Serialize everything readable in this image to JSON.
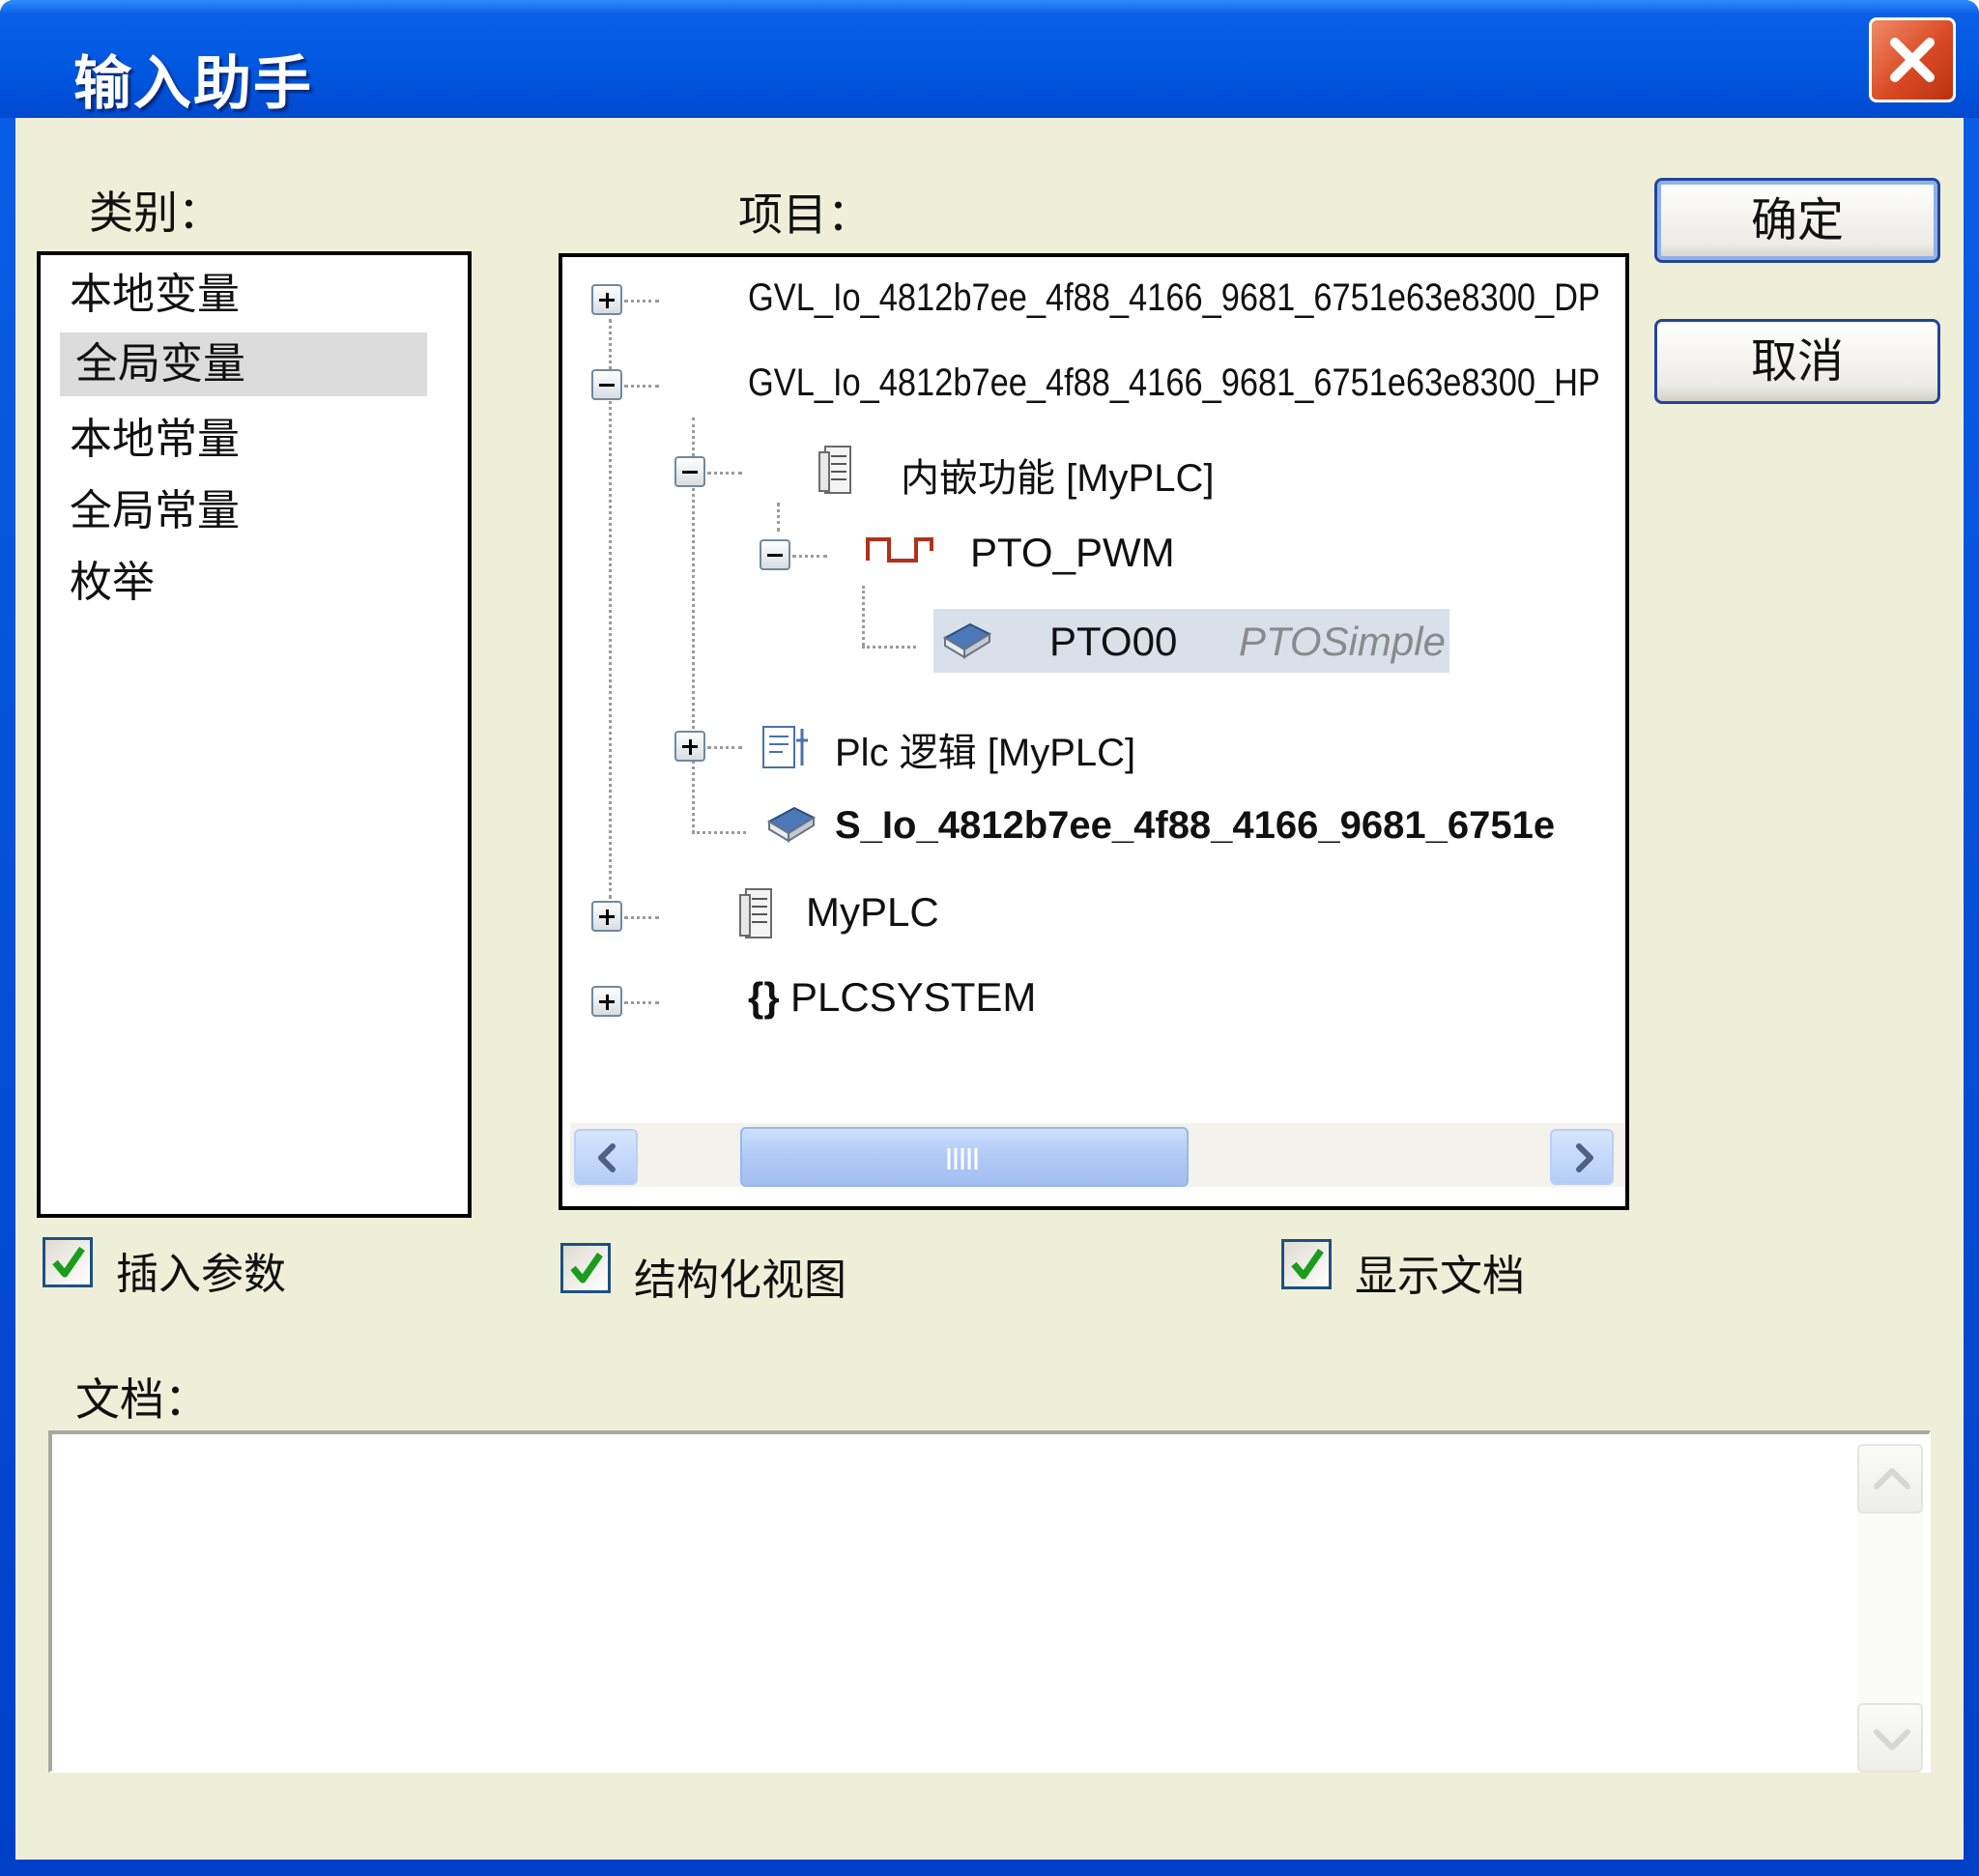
{
  "window": {
    "title": "输入助手"
  },
  "categories": {
    "label": "类别：",
    "items": [
      "本地变量",
      "全局变量",
      "本地常量",
      "全局常量",
      "枚举"
    ],
    "selected": "全局变量"
  },
  "items_panel": {
    "label": "项目：",
    "tree": {
      "gvl_dp": "GVL_Io_4812b7ee_4f88_4166_9681_6751e63e8300_DP",
      "gvl_hp": "GVL_Io_4812b7ee_4f88_4166_9681_6751e63e8300_HP",
      "embedded": "内嵌功能 [MyPLC]",
      "pto_pwm": "PTO_PWM",
      "pto00_name": "PTO00",
      "pto00_type": "PTOSimple",
      "plc_logic": "Plc 逻辑 [MyPLC]",
      "s_io": "S_Io_4812b7ee_4f88_4166_9681_6751e",
      "myplc": "MyPLC",
      "plcsystem_icon": "{}",
      "plcsystem": "PLCSYSTEM"
    }
  },
  "buttons": {
    "ok": "确定",
    "cancel": "取消"
  },
  "options": {
    "insert_args": {
      "label": "插入参数",
      "checked": true
    },
    "structured_view": {
      "label": "结构化视图",
      "checked": true
    },
    "show_docs": {
      "label": "显示文档",
      "checked": true
    }
  },
  "documentation": {
    "label": "文档：",
    "content": ""
  },
  "colors": {
    "title_blue": "#0057e0",
    "client_bg": "#efefd9",
    "check_green": "#1c9c1c",
    "selection_bg": "#d9e0ea",
    "close_red": "#d94a24"
  }
}
